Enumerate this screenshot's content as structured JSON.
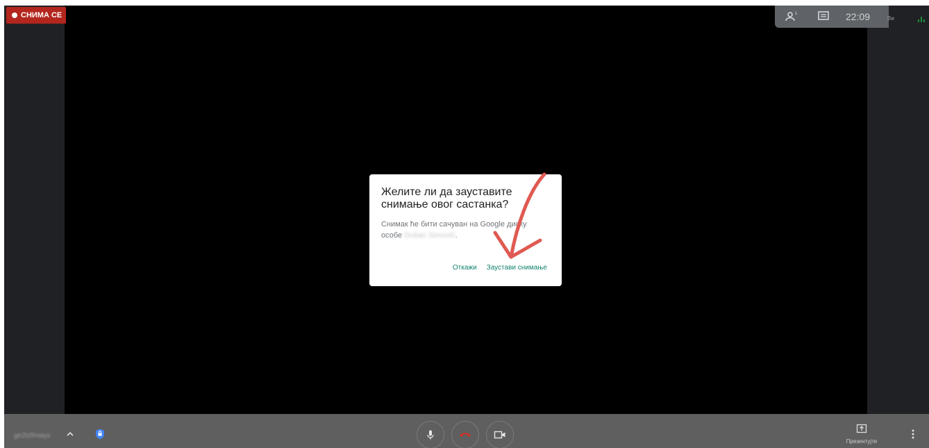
{
  "recording_badge": {
    "label": "СНИМА СЕ"
  },
  "topbar": {
    "people_icon": "people-icon",
    "people_count": "1",
    "chat_icon": "chat-icon",
    "clock": "22:09"
  },
  "self_tile": {
    "label": "Ви"
  },
  "dialog": {
    "title": "Желите ли да зауставите снимање овог састанка?",
    "body_prefix": "Снимак ће бити сачуван на Google диску особе",
    "body_name": "Dušan Simović",
    "body_suffix": ".",
    "cancel_label": "Откажи",
    "confirm_label": "Заустави снимање",
    "accent_color": "#12846f"
  },
  "bottombar": {
    "meeting_code": "ge2tzfmwyx",
    "present_label": "Презентујте",
    "end_call_color": "#d93025"
  },
  "annotation": {
    "color": "#e05a52"
  }
}
